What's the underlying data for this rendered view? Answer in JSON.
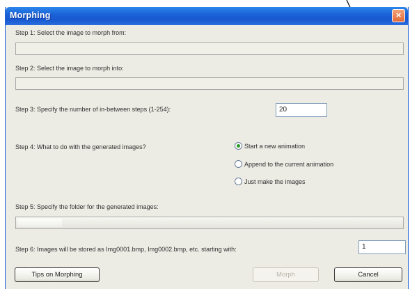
{
  "window": {
    "title": "Morphing",
    "close_glyph": "×"
  },
  "step1": {
    "label": "Step 1: Select the image to morph from:",
    "value": ""
  },
  "step2": {
    "label": "Step 2: Select the image to morph into:",
    "value": ""
  },
  "step3": {
    "label": "Step 3: Specify the number of in-between steps (1-254):",
    "value": "20"
  },
  "step4": {
    "label": "Step 4: What to do with the generated images?",
    "options": [
      {
        "label": "Start a new animation",
        "selected": true
      },
      {
        "label": "Append to the current animation",
        "selected": false
      },
      {
        "label": "Just make the images",
        "selected": false
      }
    ]
  },
  "step5": {
    "label": "Step 5: Specify the folder for the generated images:"
  },
  "step6": {
    "label": "Step 6: Images will be stored as Img0001.bmp, Img0002.bmp, etc. starting with:",
    "value": "1"
  },
  "buttons": {
    "tips": "Tips on Morphing",
    "morph": "Morph",
    "cancel": "Cancel"
  },
  "colors": {
    "titlebar": "#1b63d9",
    "dialog_bg": "#ecebe4",
    "radio_selected": "#2b9a2b",
    "close_button": "#e36a38"
  },
  "icons": {
    "close": "close-icon",
    "radio": "radio-icon"
  }
}
